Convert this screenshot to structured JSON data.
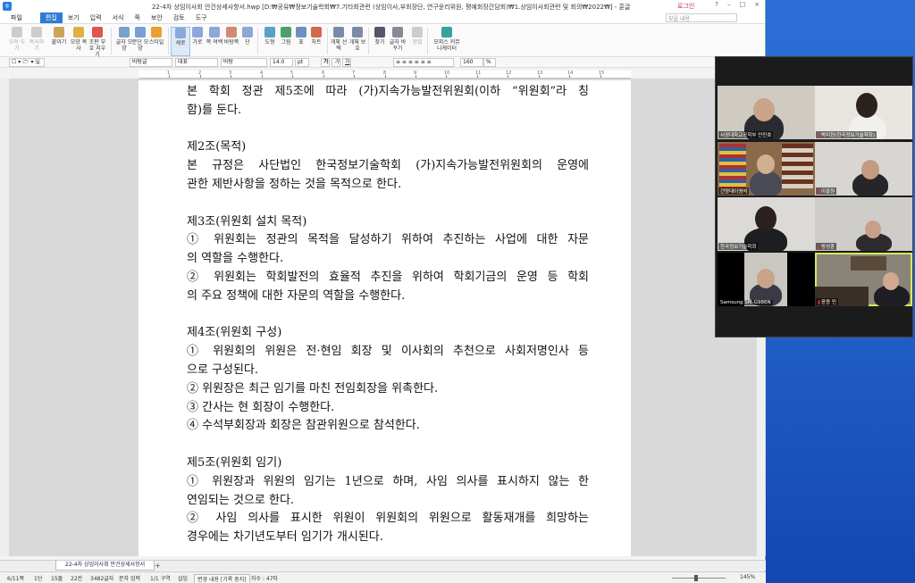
{
  "window": {
    "title": "22-4차 상임이사회 안건상세사항서.hwp [D:₩공유₩정보기술학회₩7.기타회관련 (상임이사,부회장단, 연구윤리위원, 평예회장간담회)₩1.상임이사회관련 및 회의₩2022₩] - 훈글",
    "login": "로그인",
    "controls": [
      "?",
      "–",
      "□",
      "×"
    ]
  },
  "menu": {
    "file": "파일",
    "items": [
      "편집",
      "보기",
      "입력",
      "서식",
      "쪽",
      "보안",
      "검토",
      "도구"
    ],
    "active": "편집",
    "search_placeholder": "찾을 내용"
  },
  "ribbon": {
    "buttons": [
      "오려 두기",
      "복사하기",
      "붙이기",
      "모양 복사",
      "조판 부호 지우기",
      "글자 모양",
      "문단 모양",
      "스타일",
      "세로",
      "가로",
      "쪽 여백",
      "바탕쪽",
      "단",
      "도형",
      "그림",
      "표",
      "차트",
      "개체 선택",
      "개체 보호",
      "찾기",
      "글자 바꾸기",
      "정렬",
      "모피스 커뮤니케이터"
    ]
  },
  "format": {
    "style": "바탕글",
    "lang": "대표",
    "font": "바탕",
    "size": "14.0",
    "unit": "pt",
    "bold": "가",
    "italic": "가",
    "underline": "가",
    "zoom": "160",
    "zoom_unit": "%"
  },
  "ruler": {
    "numbers": [
      "1",
      "2",
      "3",
      "4",
      "5",
      "6",
      "7",
      "8",
      "9",
      "10",
      "11",
      "12",
      "13",
      "14",
      "15"
    ]
  },
  "document": {
    "lines": [
      "본 학회 정관 제5조에 따라 (가)지속가능발전위원회(이하 “위원회”라 칭",
      "함)를 둔다.",
      "",
      "제2조(목적)",
      "본 규정은 사단법인 한국정보기술학회 (가)지속가능발전위원회의 운영에",
      "관한 제반사항을 정하는 것을 목적으로 한다.",
      "",
      "제3조(위원회 설치 목적)",
      "① 위원회는 정관의 목적을 달성하기 위하여 추진하는 사업에 대한 자문",
      "의 역할을 수행한다.",
      "② 위원회는 학회발전의 효율적 추진을 위하여 학회기금의 운영 등 학회",
      "의 주요 정책에 대한 자문의 역할을 수행한다.",
      "",
      "제4조(위원회 구성)",
      "① 위원회의 위원은 전·현임 회장 및 이사회의 추천으로 사회저명인사 등",
      "으로 구성된다.",
      "② 위원장은 최근 임기를 마친 전임회장을 위촉한다.",
      "③ 간사는 현 회장이 수행한다.",
      "④ 수석부회장과 회장은 참관위원으로 참석한다.",
      "",
      "제5조(위원회 임기)",
      "① 위원장과 위원의 임기는 1년으로 하며, 사임 의사를 표시하지 않는 한",
      "연임되는 것으로 한다.",
      "② 사임 의사를 표시한 위원이 위원회의 위원으로 활동재개를 희망하는",
      "경우에는 차기년도부터 임기가 개시된다."
    ]
  },
  "tabs": {
    "doc_tab": "22-4차 상임이사회 안건상세사항서",
    "add": "+"
  },
  "status": {
    "page": "6/11쪽",
    "col": "1단",
    "line": "15줄",
    "pos": "22칸",
    "chars": "3482글자",
    "mode": "문자 입력",
    "section": "1/1 구역",
    "insert": "삽입",
    "track": "변경 내용 [기록 중지]",
    "revisions": "자수 : 47타",
    "zoom": "145%"
  },
  "zoom_panel": {
    "tiles": [
      {
        "name": "서경대학교공학부 안진호",
        "muted": false,
        "active": false
      },
      {
        "name": "박미현(한국정보기술학회)",
        "muted": true,
        "active": false
      },
      {
        "name": "건양대이영석",
        "muted": false,
        "active": false
      },
      {
        "name": "이홍원",
        "muted": true,
        "active": false
      },
      {
        "name": "한국정보기술학회",
        "muted": false,
        "active": false
      },
      {
        "name": "방성훈",
        "muted": true,
        "active": false
      },
      {
        "name": "Samsung SM-G986N",
        "muted": false,
        "active": false
      },
      {
        "name": "윤종 민",
        "muted": true,
        "active": true
      }
    ]
  }
}
